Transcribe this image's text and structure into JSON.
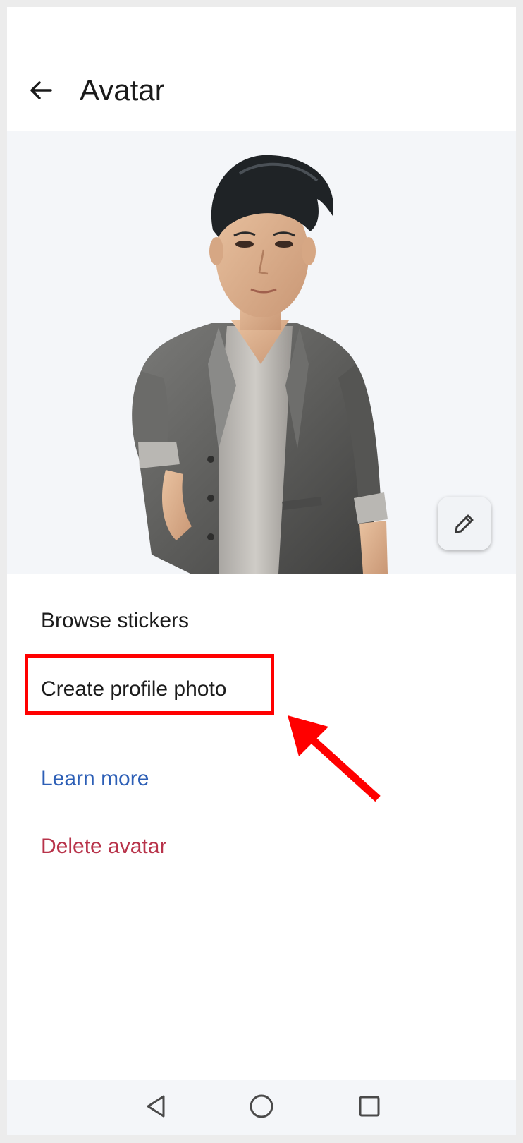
{
  "app_bar": {
    "title": "Avatar",
    "back_icon": "arrow-left-icon"
  },
  "hero": {
    "avatar_image": "3d-avatar-figure",
    "edit_icon": "pencil-icon"
  },
  "menu": {
    "items": [
      {
        "label": "Browse stickers"
      },
      {
        "label": "Create profile photo"
      }
    ]
  },
  "links": {
    "learn_more": "Learn more",
    "delete_avatar": "Delete avatar"
  },
  "annotation": {
    "highlight_color": "#ff0000",
    "highlight_target": "Create profile photo"
  },
  "nav_bar": {
    "back_icon": "triangle-back-icon",
    "home_icon": "circle-home-icon",
    "recents_icon": "square-recents-icon"
  },
  "colors": {
    "link": "#2d5fb6",
    "danger": "#b8334a",
    "hero_bg": "#f4f6f9"
  }
}
